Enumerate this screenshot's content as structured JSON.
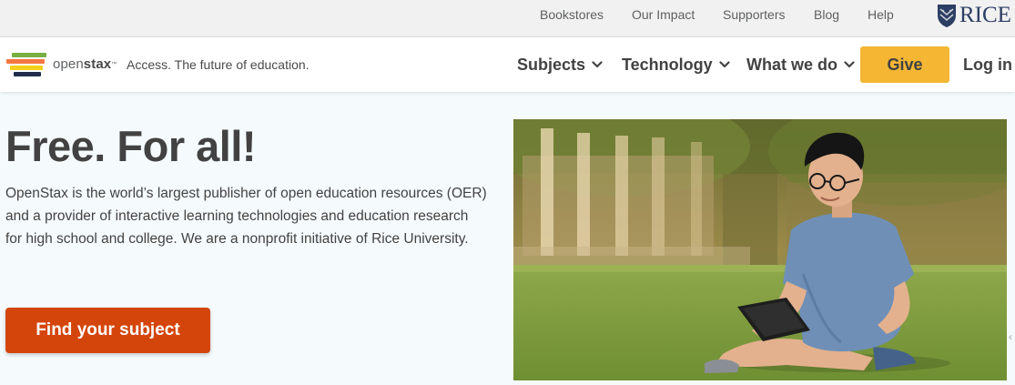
{
  "utility_nav": {
    "links": [
      "Bookstores",
      "Our Impact",
      "Supporters",
      "Blog",
      "Help"
    ],
    "rice_logo_text": "RICE"
  },
  "header": {
    "logo": {
      "word_light": "open",
      "word_bold": "stax",
      "trademark": "™"
    },
    "tagline": "Access. The future of education.",
    "menu": [
      {
        "label": "Subjects",
        "icon": "chevron-down-icon"
      },
      {
        "label": "Technology",
        "icon": "chevron-down-icon"
      },
      {
        "label": "What we do",
        "icon": "chevron-down-icon"
      }
    ],
    "give_label": "Give",
    "login_label": "Log in"
  },
  "hero": {
    "title": "Free. For all!",
    "description": "OpenStax is the world’s largest publisher of open education resources (OER) and a provider of interactive learning technologies and education research for high school and college. We are a nonprofit initiative of Rice University.",
    "cta_label": "Find your subject"
  },
  "colors": {
    "give_button": "#f4b633",
    "cta_button": "#d4450c",
    "hero_background": "#f5fbfd",
    "utility_bar": "#f1f1f1",
    "rice_blue": "#2d3e63",
    "logo_green": "#77af42",
    "logo_yellow": "#f4d019",
    "logo_orange": "#f47641",
    "logo_navy": "#232d4b"
  }
}
